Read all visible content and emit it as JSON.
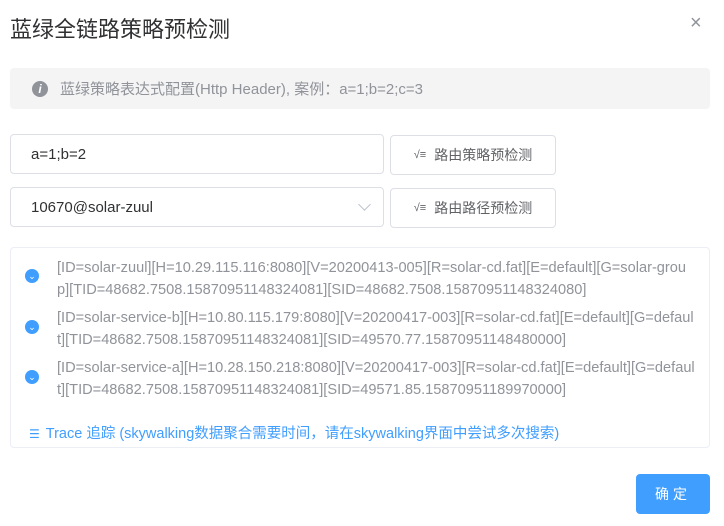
{
  "dialog": {
    "title": "蓝绿全链路策略预检测",
    "close_icon": "×"
  },
  "alert": {
    "icon": "i",
    "text": "蓝绿策略表达式配置(Http Header), 案例：a=1;b=2;c=3"
  },
  "strategy_input": {
    "value": "a=1;b=2"
  },
  "strategy_button": {
    "icon": "√≡",
    "label": "路由策略预检测"
  },
  "service_select": {
    "value": "10670@solar-zuul"
  },
  "path_button": {
    "icon": "√≡",
    "label": "路由路径预检测"
  },
  "results": [
    "[ID=solar-zuul][H=10.29.115.116:8080][V=20200413-005][R=solar-cd.fat][E=default][G=solar-group][TID=48682.7508.15870951148324081][SID=48682.7508.15870951148324080]",
    "[ID=solar-service-b][H=10.80.115.179:8080][V=20200417-003][R=solar-cd.fat][E=default][G=default][TID=48682.7508.15870951148324081][SID=49570.77.15870951148480000]",
    "[ID=solar-service-a][H=10.28.150.218:8080][V=20200417-003][R=solar-cd.fat][E=default][G=default][TID=48682.7508.15870951148324081][SID=49571.85.15870951189970000]"
  ],
  "trace": {
    "icon": "☰",
    "label": "Trace 追踪 (skywalking数据聚合需要时间，请在skywalking界面中尝试多次搜索)"
  },
  "confirm_button": {
    "label": "确定"
  }
}
